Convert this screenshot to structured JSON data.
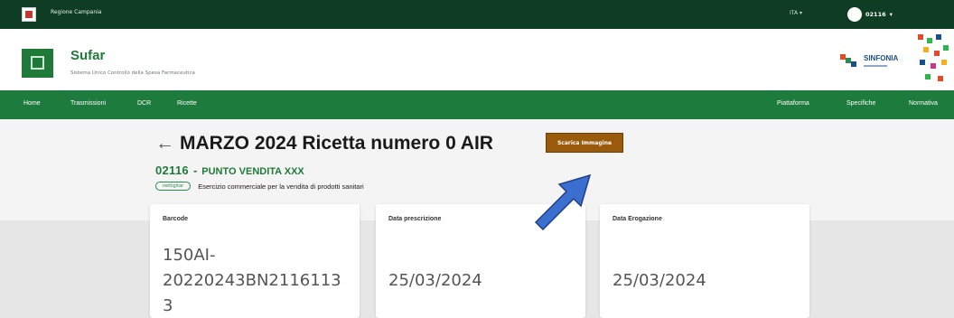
{
  "topbar": {
    "region": "Regione Campania",
    "language": "ITA",
    "user": "02116"
  },
  "header": {
    "app_name": "Sufar",
    "app_subtitle": "Sistema Unico Controllo della Spesa Farmaceutica",
    "partner_logo": "SINFONIA"
  },
  "nav": {
    "left_items": [
      "Home",
      "Trasmissioni",
      "DCR",
      "Ricette"
    ],
    "right_items": [
      "Piattaforma",
      "Specifiche",
      "Normativa"
    ]
  },
  "page": {
    "title": "MARZO 2024 Ricetta numero 0 AIR",
    "back_icon": "arrow-left-icon",
    "download_label": "Scarica Immagine",
    "store_code": "02116",
    "store_separator": "-",
    "store_name": "PUNTO VENDITA XXX",
    "store_type_pill": "nettigitar",
    "store_type_desc": "Esercizio commerciale per la vendita di prodotti sanitari"
  },
  "cards": [
    {
      "label": "Barcode",
      "value_lines": [
        "150AI-",
        "20220243BN2116113",
        "3"
      ]
    },
    {
      "label": "Data prescrizione",
      "value": "25/03/2024"
    },
    {
      "label": "Data Erogazione",
      "value": "25/03/2024"
    }
  ],
  "colors": {
    "topbar": "#0f3d24",
    "nav": "#1e7b3e",
    "brand_green": "#1f7a3a",
    "download_button": "#9a5a0c",
    "annotation_arrow": "#3a6fd0"
  }
}
